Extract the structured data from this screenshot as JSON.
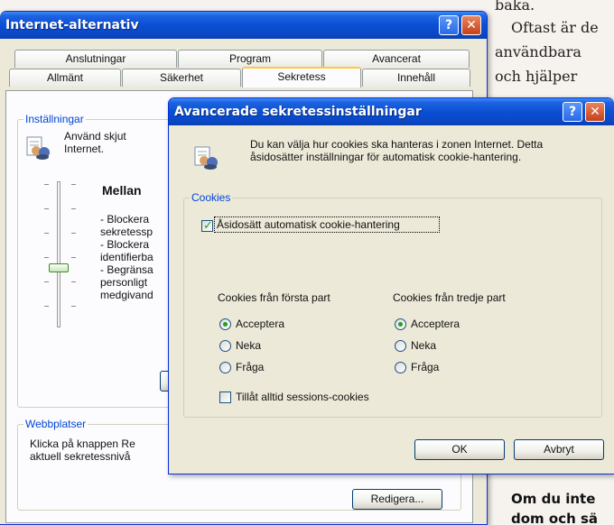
{
  "magazine": {
    "line1": "baka.",
    "line2": "Oftast är de",
    "line3": "användbara",
    "line4": "och    hjälper",
    "bold1": "Om du inte",
    "bold2": "dom och sä"
  },
  "back_window": {
    "title": "Internet-alternativ",
    "tabs_row1": [
      "Anslutningar",
      "Program",
      "Avancerat"
    ],
    "tabs_row2": [
      "Allmänt",
      "Säkerhet",
      "Sekretess",
      "Innehåll"
    ],
    "active_tab": "Sekretess",
    "settings_group": "Inställningar",
    "settings_desc1": "Använd skjut",
    "settings_desc2": "Internet.",
    "level_title": "Mellan",
    "level_lines": [
      "- Blockera",
      "sekretessp",
      "- Blockera",
      "identifierba",
      "- Begränsa",
      "personligt",
      "medgivand"
    ],
    "slider_level": "Mellan",
    "websites_group": "Webbplatser",
    "websites_text1": "Klicka på knappen Re",
    "websites_text2": "aktuell sekretessnivå",
    "edit_button": "Redigera..."
  },
  "dialog": {
    "title": "Avancerade sekretessinställningar",
    "intro1": "Du kan välja hur cookies ska hanteras i zonen Internet. Detta",
    "intro2": "åsidosätter inställningar för automatisk cookie-hantering.",
    "group_label": "Cookies",
    "override_label": "Åsidosätt automatisk cookie-hantering",
    "override_checked": true,
    "first_party_label": "Cookies från första part",
    "third_party_label": "Cookies från tredje part",
    "first_party_options": [
      "Acceptera",
      "Neka",
      "Fråga"
    ],
    "third_party_options": [
      "Acceptera",
      "Neka",
      "Fråga"
    ],
    "first_party_selected": "Acceptera",
    "third_party_selected": "Acceptera",
    "session_label": "Tillåt alltid sessions-cookies",
    "session_checked": false,
    "ok_button": "OK",
    "cancel_button": "Avbryt"
  },
  "icons": {
    "help": "help-icon",
    "close": "close-icon",
    "privacy": "privacy-icon"
  },
  "colors": {
    "titlebar": "#0a4fd4",
    "window": "#ece9d8",
    "group_label": "#0046d5",
    "check": "#21a121",
    "active_tab": "#ffc83c"
  }
}
